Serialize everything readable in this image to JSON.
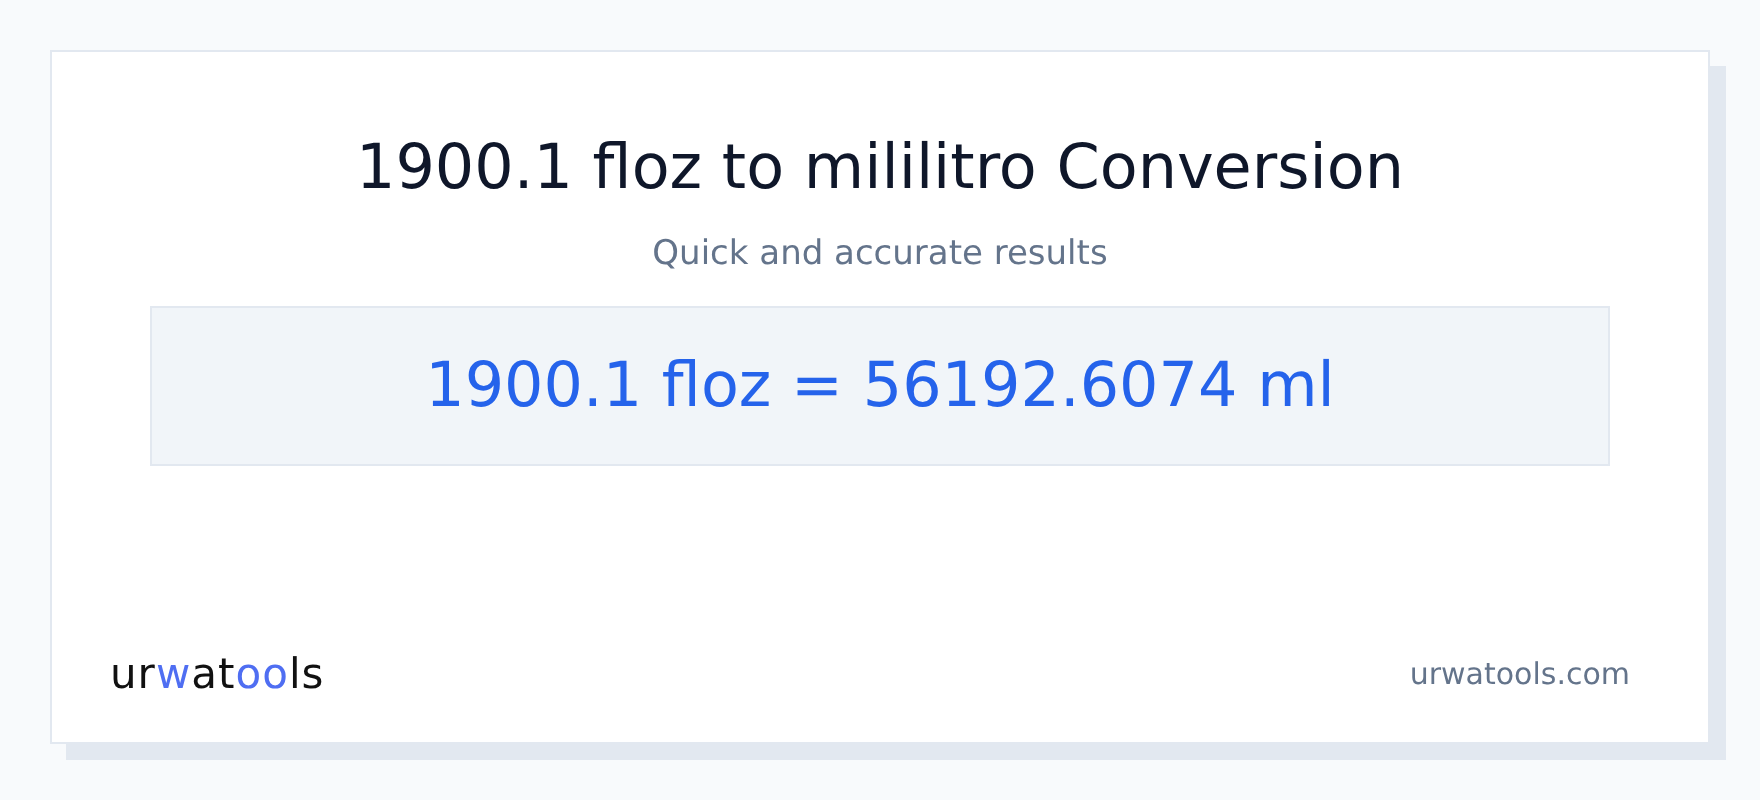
{
  "title": "1900.1 floz to mililitro Conversion",
  "subtitle": "Quick and accurate results",
  "result": "1900.1 floz = 56192.6074 ml",
  "logo": [
    {
      "text": "ur",
      "accent": false
    },
    {
      "text": "w",
      "accent": true
    },
    {
      "text": "at",
      "accent": false
    },
    {
      "text": "oo",
      "accent": true
    },
    {
      "text": "ls",
      "accent": false
    }
  ],
  "site": "urwatools.com"
}
